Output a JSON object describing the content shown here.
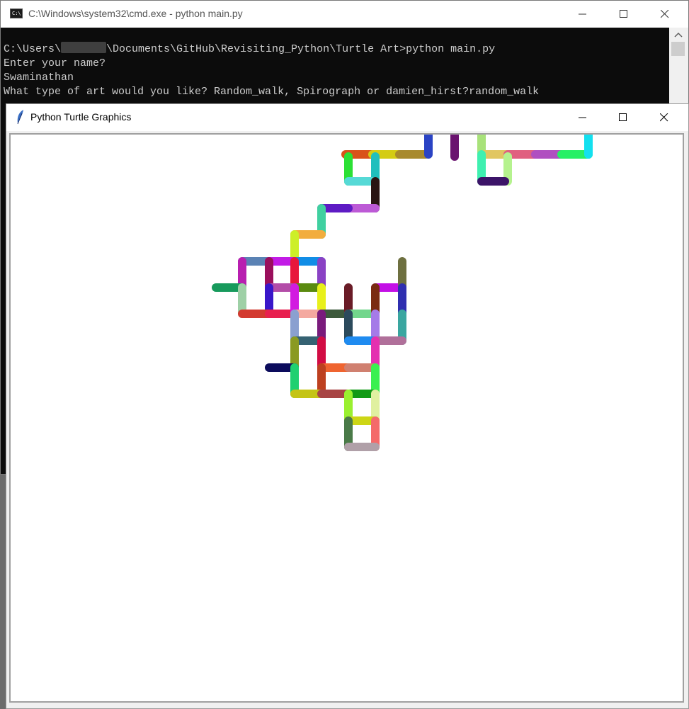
{
  "cmd": {
    "title": "C:\\Windows\\system32\\cmd.exe - python  main.py",
    "path_before": "C:\\Users\\",
    "path_after": "\\Documents\\GitHub\\Revisiting_Python\\Turtle Art>python main.py",
    "line2": "Enter your name?",
    "line3": "Swaminathan",
    "line4": "What type of art would you like? Random_walk, Spirograph or damien_hirst?random_walk"
  },
  "turtle": {
    "title": "Python Turtle Graphics"
  },
  "icons": {
    "cmd": "cmd-icon",
    "turtle": "feather-icon",
    "minimize": "minimize-icon",
    "maximize": "maximize-icon",
    "close": "close-icon"
  },
  "walk_segments": [
    [
      "#d9521a",
      [
        487,
        217
      ],
      [
        525,
        217
      ]
    ],
    [
      "#d4cc13",
      [
        525,
        217
      ],
      [
        563,
        217
      ]
    ],
    [
      "#a88a2d",
      [
        563,
        217
      ],
      [
        600,
        217
      ]
    ],
    [
      "#2a43c4",
      [
        604,
        190
      ],
      [
        604,
        217
      ]
    ],
    [
      "#6a136f",
      [
        641,
        190
      ],
      [
        641,
        220
      ]
    ],
    [
      "#a8e27a",
      [
        679,
        190
      ],
      [
        679,
        217
      ]
    ],
    [
      "#e1c661",
      [
        679,
        217
      ],
      [
        716,
        217
      ]
    ],
    [
      "#e06080",
      [
        716,
        217
      ],
      [
        755,
        217
      ]
    ],
    [
      "#b04fc0",
      [
        755,
        217
      ],
      [
        792,
        217
      ]
    ],
    [
      "#27f065",
      [
        792,
        217
      ],
      [
        830,
        217
      ]
    ],
    [
      "#13e0ef",
      [
        830,
        190
      ],
      [
        830,
        217
      ]
    ],
    [
      "#3ff0b0",
      [
        679,
        217
      ],
      [
        679,
        255
      ]
    ],
    [
      "#b5f28e",
      [
        716,
        220
      ],
      [
        716,
        255
      ]
    ],
    [
      "#3c1468",
      [
        679,
        255
      ],
      [
        712,
        255
      ]
    ],
    [
      "#2be034",
      [
        491,
        220
      ],
      [
        491,
        255
      ]
    ],
    [
      "#20bfbd",
      [
        529,
        220
      ],
      [
        529,
        255
      ]
    ],
    [
      "#56d9d6",
      [
        491,
        255
      ],
      [
        529,
        255
      ]
    ],
    [
      "#2a1413",
      [
        529,
        255
      ],
      [
        529,
        293
      ]
    ],
    [
      "#bd5ad6",
      [
        491,
        293
      ],
      [
        529,
        293
      ]
    ],
    [
      "#5e1bc4",
      [
        453,
        293
      ],
      [
        491,
        293
      ]
    ],
    [
      "#40d0a0",
      [
        453,
        293
      ],
      [
        453,
        330
      ]
    ],
    [
      "#f2ad3e",
      [
        415,
        330
      ],
      [
        453,
        330
      ]
    ],
    [
      "#cdef28",
      [
        415,
        330
      ],
      [
        415,
        368
      ]
    ],
    [
      "#5a82b4",
      [
        341,
        368
      ],
      [
        379,
        368
      ]
    ],
    [
      "#c21be6",
      [
        379,
        368
      ],
      [
        415,
        368
      ]
    ],
    [
      "#118de6",
      [
        415,
        368
      ],
      [
        453,
        368
      ]
    ],
    [
      "#8a42c4",
      [
        453,
        368
      ],
      [
        453,
        405
      ]
    ],
    [
      "#b81fb0",
      [
        341,
        368
      ],
      [
        341,
        405
      ]
    ],
    [
      "#9a0f5c",
      [
        379,
        368
      ],
      [
        379,
        405
      ]
    ],
    [
      "#e8173c",
      [
        415,
        368
      ],
      [
        415,
        405
      ]
    ],
    [
      "#b34ca8",
      [
        379,
        405
      ],
      [
        415,
        405
      ]
    ],
    [
      "#5a8a0f",
      [
        415,
        405
      ],
      [
        453,
        405
      ]
    ],
    [
      "#179a5c",
      [
        304,
        405
      ],
      [
        341,
        405
      ]
    ],
    [
      "#9ed0a6",
      [
        341,
        405
      ],
      [
        341,
        442
      ]
    ],
    [
      "#3916c9",
      [
        379,
        405
      ],
      [
        379,
        442
      ]
    ],
    [
      "#e8f01b",
      [
        453,
        405
      ],
      [
        453,
        442
      ]
    ],
    [
      "#d33a30",
      [
        341,
        442
      ],
      [
        379,
        442
      ]
    ],
    [
      "#e8204f",
      [
        379,
        442
      ],
      [
        415,
        442
      ]
    ],
    [
      "#d21be0",
      [
        415,
        405
      ],
      [
        415,
        442
      ]
    ],
    [
      "#f4a9a0",
      [
        415,
        442
      ],
      [
        453,
        442
      ]
    ],
    [
      "#3d5a3c",
      [
        453,
        442
      ],
      [
        491,
        442
      ]
    ],
    [
      "#6a1c27",
      [
        491,
        405
      ],
      [
        491,
        442
      ]
    ],
    [
      "#72d68c",
      [
        491,
        442
      ],
      [
        529,
        442
      ]
    ],
    [
      "#c30fe6",
      [
        529,
        405
      ],
      [
        563,
        405
      ]
    ],
    [
      "#6e7040",
      [
        567,
        368
      ],
      [
        567,
        405
      ]
    ],
    [
      "#2f2fb0",
      [
        567,
        405
      ],
      [
        567,
        442
      ]
    ],
    [
      "#7a2b12",
      [
        529,
        405
      ],
      [
        529,
        442
      ]
    ],
    [
      "#8aa0d0",
      [
        415,
        442
      ],
      [
        415,
        480
      ]
    ],
    [
      "#7a1b7c",
      [
        453,
        442
      ],
      [
        453,
        480
      ]
    ],
    [
      "#2b4a5c",
      [
        491,
        442
      ],
      [
        491,
        480
      ]
    ],
    [
      "#a57be8",
      [
        529,
        442
      ],
      [
        529,
        480
      ]
    ],
    [
      "#3aa6a0",
      [
        567,
        442
      ],
      [
        567,
        480
      ]
    ],
    [
      "#356272",
      [
        415,
        480
      ],
      [
        453,
        480
      ]
    ],
    [
      "#1f8bf0",
      [
        491,
        480
      ],
      [
        529,
        480
      ]
    ],
    [
      "#b0709a",
      [
        529,
        480
      ],
      [
        567,
        480
      ]
    ],
    [
      "#8a9a22",
      [
        415,
        480
      ],
      [
        415,
        518
      ]
    ],
    [
      "#d20c44",
      [
        453,
        480
      ],
      [
        453,
        518
      ]
    ],
    [
      "#e430b0",
      [
        529,
        480
      ],
      [
        529,
        518
      ]
    ],
    [
      "#0c0c5c",
      [
        379,
        518
      ],
      [
        415,
        518
      ]
    ],
    [
      "#ef6430",
      [
        453,
        518
      ],
      [
        491,
        518
      ]
    ],
    [
      "#d08070",
      [
        491,
        518
      ],
      [
        529,
        518
      ]
    ],
    [
      "#1fd070",
      [
        415,
        518
      ],
      [
        415,
        555
      ]
    ],
    [
      "#bd4020",
      [
        453,
        518
      ],
      [
        453,
        555
      ]
    ],
    [
      "#3af050",
      [
        529,
        518
      ],
      [
        529,
        555
      ]
    ],
    [
      "#c4c415",
      [
        415,
        555
      ],
      [
        453,
        555
      ]
    ],
    [
      "#a84444",
      [
        453,
        555
      ],
      [
        491,
        555
      ]
    ],
    [
      "#129a16",
      [
        491,
        555
      ],
      [
        529,
        555
      ]
    ],
    [
      "#9af02f",
      [
        491,
        555
      ],
      [
        491,
        593
      ]
    ],
    [
      "#e0f0a0",
      [
        529,
        555
      ],
      [
        529,
        593
      ]
    ],
    [
      "#cdd615",
      [
        491,
        593
      ],
      [
        529,
        593
      ]
    ],
    [
      "#4a7a48",
      [
        491,
        593
      ],
      [
        491,
        630
      ]
    ],
    [
      "#f46a6a",
      [
        529,
        593
      ],
      [
        529,
        630
      ]
    ],
    [
      "#b0a0a8",
      [
        491,
        630
      ],
      [
        529,
        630
      ]
    ]
  ]
}
